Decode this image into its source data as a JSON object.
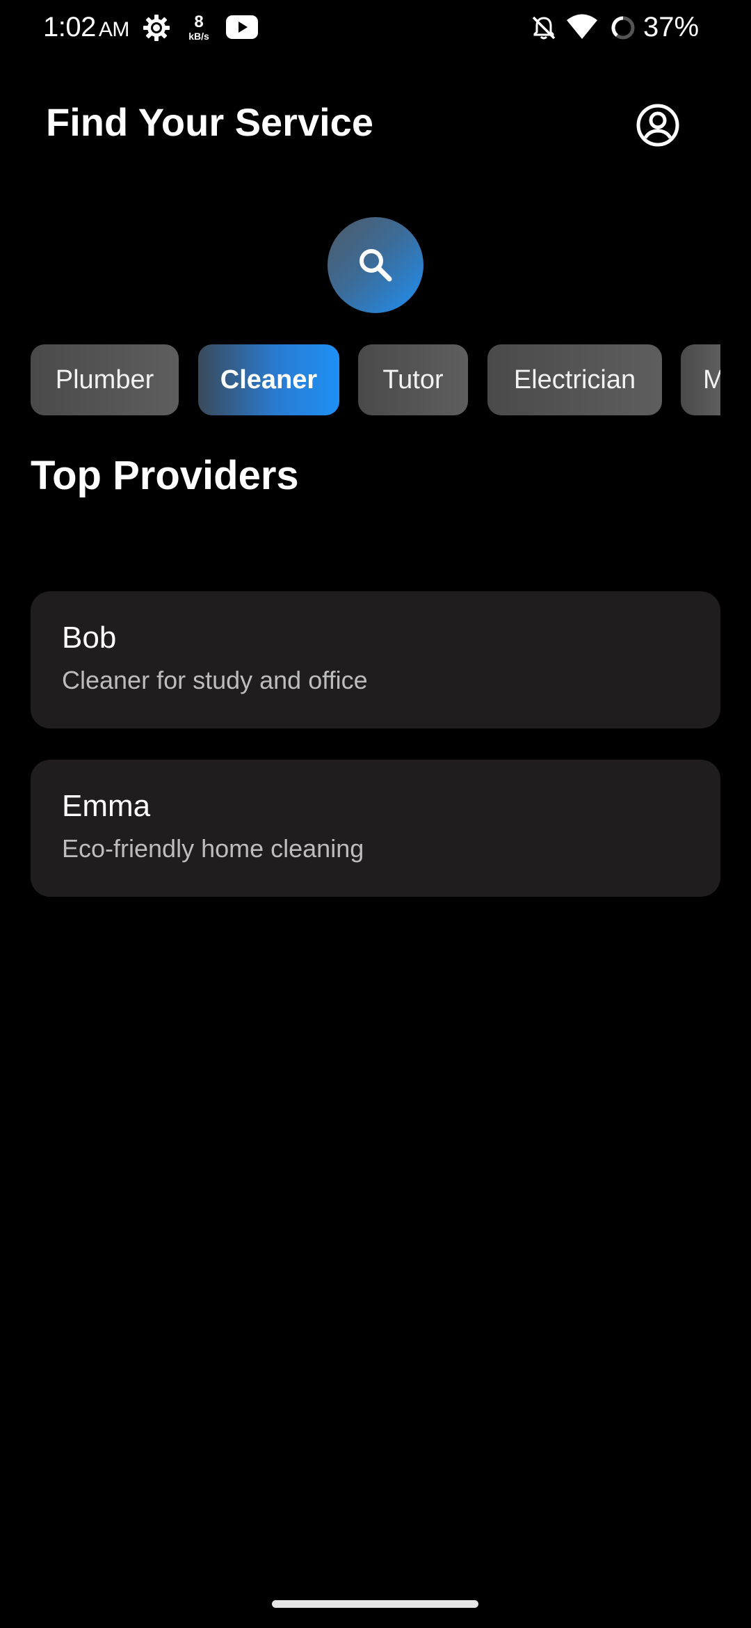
{
  "status_bar": {
    "time": "1:02",
    "ampm": "AM",
    "net_speed_value": "8",
    "net_speed_unit": "kB/s",
    "battery_percent": "37%",
    "icons": [
      "gear-icon",
      "youtube-icon",
      "bell-off-icon",
      "wifi-icon",
      "battery-icon"
    ]
  },
  "header": {
    "title": "Find Your Service",
    "profile_icon": "account-circle-icon"
  },
  "search": {
    "icon": "search-icon",
    "accent_gradient": [
      "#4e5a66",
      "#1e8ff2"
    ]
  },
  "categories": {
    "selected": "Cleaner",
    "items": [
      {
        "label": "Plumber"
      },
      {
        "label": "Cleaner"
      },
      {
        "label": "Tutor"
      },
      {
        "label": "Electrician"
      },
      {
        "label": "M"
      }
    ]
  },
  "section": {
    "title": "Top Providers"
  },
  "providers": [
    {
      "name": "Bob",
      "description": "Cleaner for study and office"
    },
    {
      "name": "Emma",
      "description": "Eco-friendly home cleaning"
    }
  ],
  "colors": {
    "background": "#000000",
    "card": "#1f1d1d",
    "chip": "#555555",
    "accent": "#1e90f5",
    "secondary_text": "#bdbdbd"
  }
}
